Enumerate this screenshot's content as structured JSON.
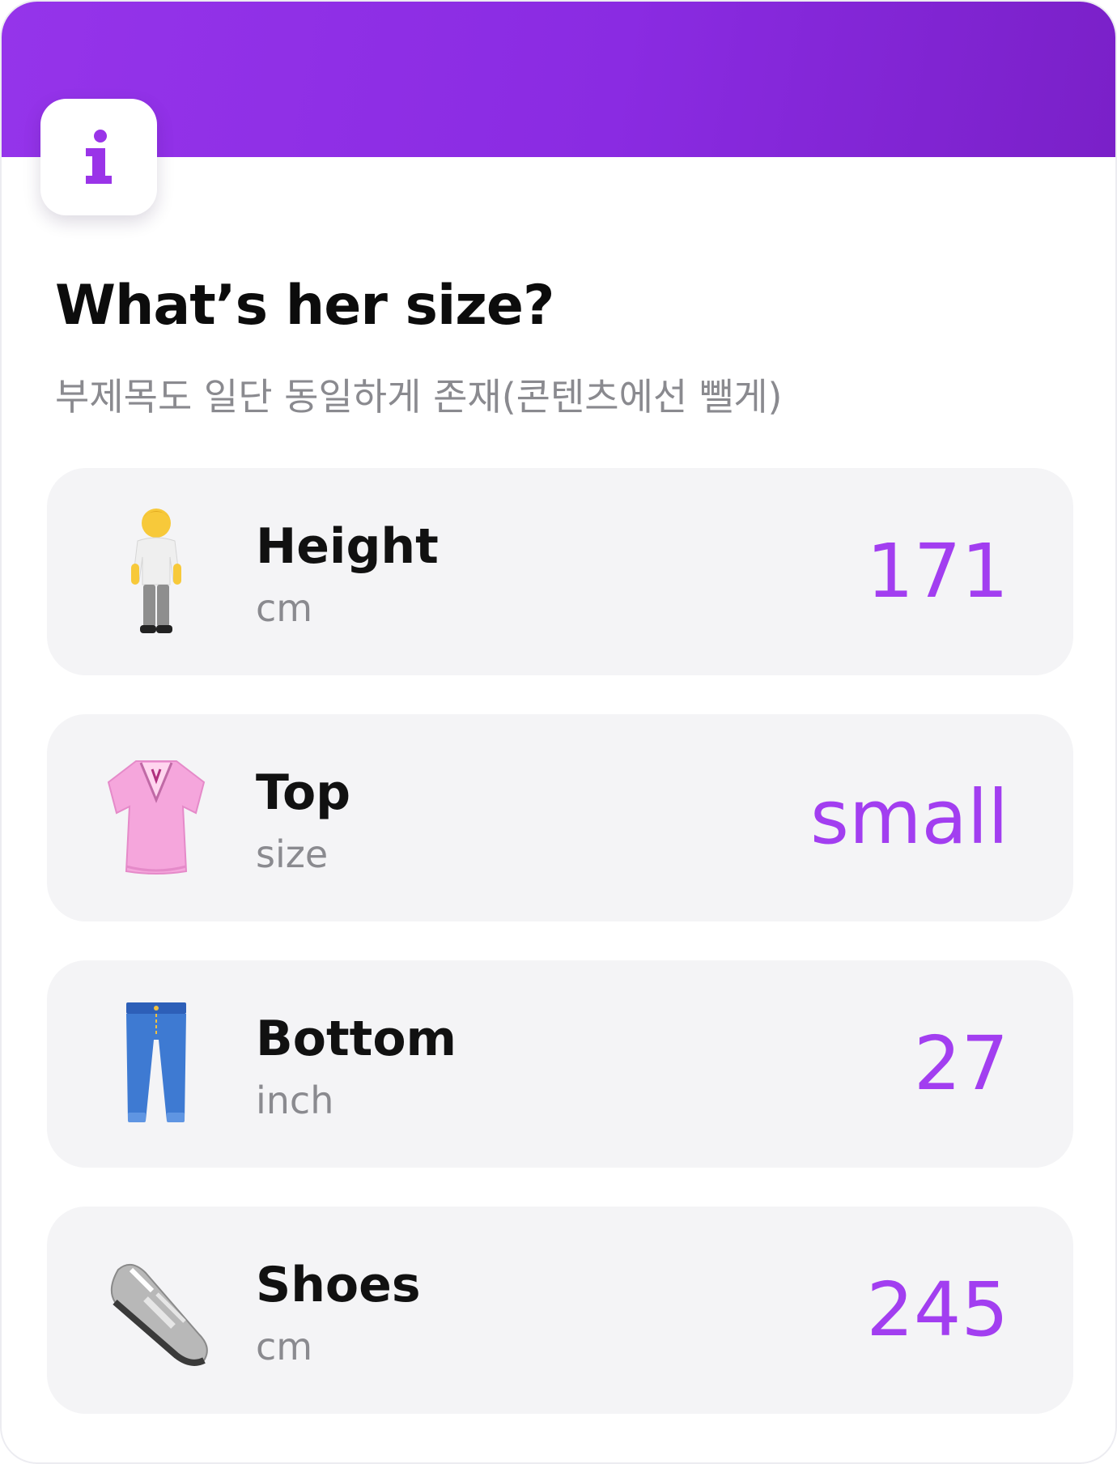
{
  "colors": {
    "accent": "#a23ef0",
    "header_gradient_start": "#9534ea",
    "header_gradient_end": "#7a20c8",
    "row_background": "#f4f4f6",
    "subtitle": "#8a8a8f"
  },
  "badge": {
    "icon": "info-icon"
  },
  "title": "What’s her size?",
  "subtitle": "부제목도 일단 동일하게 존재(콘텐츠에선 뺄게)",
  "sizes": [
    {
      "icon": "person-standing-icon",
      "label": "Height",
      "unit": "cm",
      "value": "171"
    },
    {
      "icon": "blouse-icon",
      "label": "Top",
      "unit": "size",
      "value": "small"
    },
    {
      "icon": "jeans-icon",
      "label": "Bottom",
      "unit": "inch",
      "value": "27"
    },
    {
      "icon": "sneaker-icon",
      "label": "Shoes",
      "unit": "cm",
      "value": "245"
    }
  ]
}
